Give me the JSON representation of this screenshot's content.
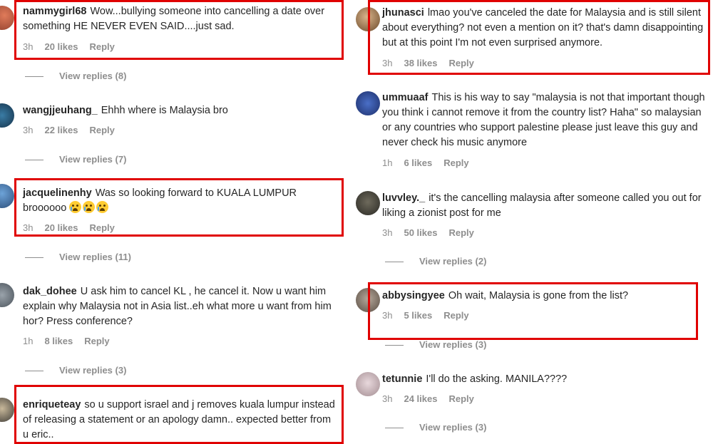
{
  "colors": {
    "highlight": "#e00000",
    "meta": "#8e8e8e",
    "text": "#262626"
  },
  "left": [
    {
      "user": "nammygirl68",
      "text": "Wow...bullying someone into cancelling a date over something HE NEVER EVEN SAID....just sad.",
      "time": "3h",
      "likes": "20 likes",
      "reply": "Reply",
      "replies": "View replies (8)"
    },
    {
      "user": "wangjjeuhang_",
      "text": "Ehhh where is Malaysia bro",
      "time": "3h",
      "likes": "22 likes",
      "reply": "Reply",
      "replies": "View replies (7)"
    },
    {
      "user": "jacquelinenhy",
      "text": "Was so looking forward to KUALA LUMPUR broooooo",
      "time": "3h",
      "likes": "20 likes",
      "reply": "Reply",
      "replies": "View replies (11)"
    },
    {
      "user": "dak_dohee",
      "text": "U ask him to cancel KL , he cancel it. Now u want him explain why Malaysia not in Asia list..eh what more u want from him hor? Press conference?",
      "time": "1h",
      "likes": "8 likes",
      "reply": "Reply",
      "replies": "View replies (3)"
    },
    {
      "user": "enriqueteay",
      "text": "so u support israel and j removes kuala lumpur instead of releasing a statement or an apology damn.. expected better from u eric.."
    }
  ],
  "right": [
    {
      "user": "jhunasci",
      "text": "lmao you've canceled the date for Malaysia and is still silent about everything? not even a mention on it? that's damn disappointing but at this point I'm not even surprised anymore.",
      "time": "3h",
      "likes": "38 likes",
      "reply": "Reply"
    },
    {
      "user": "ummuaaf",
      "text": "This is his way to say \"malaysia is not that important though you think i cannot remove it from the country list? Haha\" so malaysian or any countries who support palestine please just leave this guy and never check his music anymore",
      "time": "1h",
      "likes": "6 likes",
      "reply": "Reply"
    },
    {
      "user": "luvvley._",
      "text": "it's the cancelling malaysia after someone called you out for liking a zionist post for me",
      "time": "3h",
      "likes": "50 likes",
      "reply": "Reply",
      "replies": "View replies (2)"
    },
    {
      "user": "abbysingyee",
      "text": "Oh wait, Malaysia is gone from the list?",
      "time": "3h",
      "likes": "5 likes",
      "reply": "Reply",
      "replies": "View replies (3)"
    },
    {
      "user": "tetunnie",
      "text": "I'll do the asking. MANILA????",
      "time": "3h",
      "likes": "24 likes",
      "reply": "Reply",
      "replies": "View replies (3)"
    }
  ]
}
